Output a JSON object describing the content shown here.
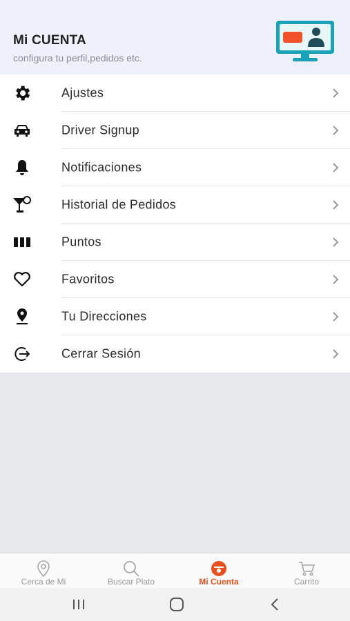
{
  "header": {
    "title": "Mi CUENTA",
    "subtitle": "configura tu perfil,pedidos etc.",
    "illustration_icon": "monitor-profile-icon"
  },
  "menu": {
    "items": [
      {
        "label": "Ajustes",
        "icon": "gear-icon"
      },
      {
        "label": "Driver Signup",
        "icon": "car-icon"
      },
      {
        "label": "Notificaciones",
        "icon": "bell-icon"
      },
      {
        "label": "Historial de Pedidos",
        "icon": "cocktail-icon"
      },
      {
        "label": "Puntos",
        "icon": "bars-icon"
      },
      {
        "label": "Favoritos",
        "icon": "heart-icon"
      },
      {
        "label": "Tu Direcciones",
        "icon": "location-pin-icon"
      },
      {
        "label": "Cerrar Sesión",
        "icon": "logout-icon"
      }
    ]
  },
  "tabs": [
    {
      "label": "Cerca de Mi",
      "icon": "map-pin-icon",
      "active": false
    },
    {
      "label": "Buscar Plato",
      "icon": "search-icon",
      "active": false
    },
    {
      "label": "Mi Cuenta",
      "icon": "user-icon",
      "active": true
    },
    {
      "label": "Carrito",
      "icon": "cart-icon",
      "active": false
    }
  ],
  "system_nav": {
    "recents_icon": "recents-icon",
    "home_icon": "home-icon",
    "back_icon": "back-icon"
  },
  "colors": {
    "accent": "#e8511d",
    "header_bg": "#eef0fb",
    "illustration_teal": "#1aa3b8",
    "illustration_orange": "#f0522a"
  }
}
